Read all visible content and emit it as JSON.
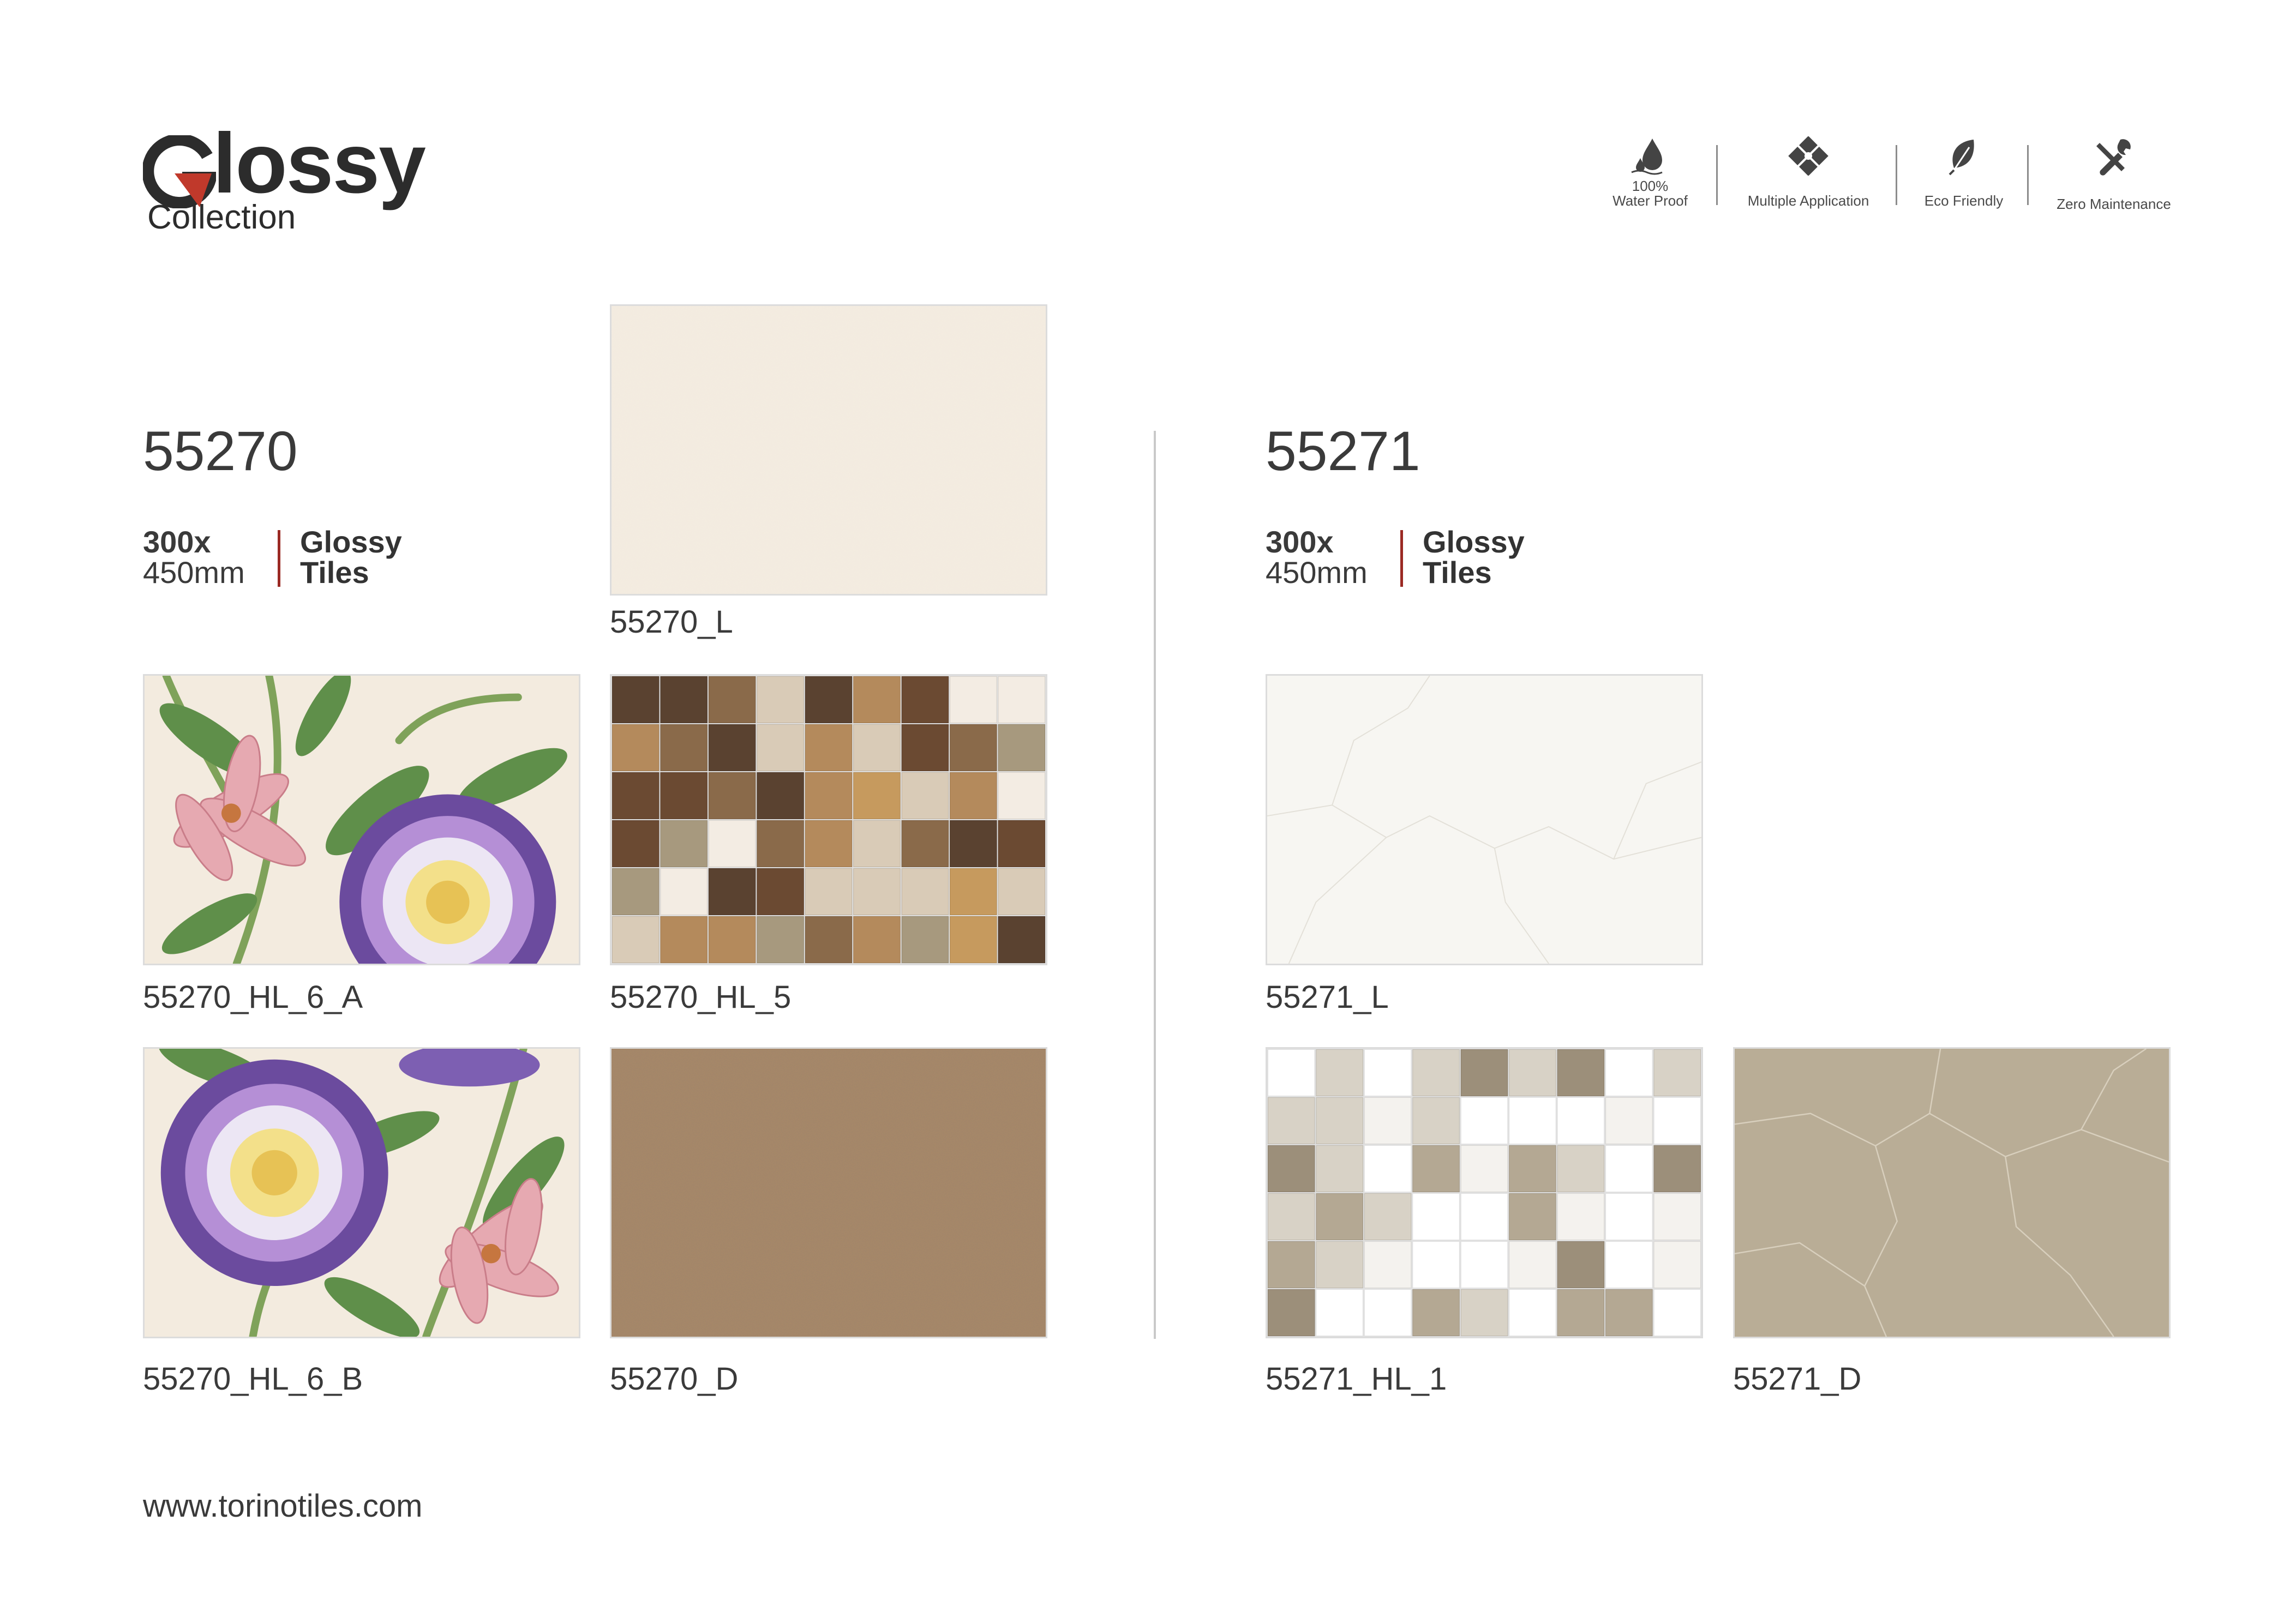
{
  "brand": {
    "logo_letter": "G",
    "word": "lossy",
    "subtitle": "Collection",
    "accent_color": "#c0392b"
  },
  "features": [
    {
      "icon": "water-drop-icon",
      "line1": "100%",
      "line2": "Water Proof"
    },
    {
      "icon": "tiles-diamond-icon",
      "line1": "",
      "line2": "Multiple Application"
    },
    {
      "icon": "leaf-icon",
      "line1": "",
      "line2": "Eco Friendly"
    },
    {
      "icon": "tools-icon",
      "line1": "",
      "line2": "Zero Maintenance"
    }
  ],
  "series": [
    {
      "code": "55270",
      "size_line1": "300x",
      "size_line2": "450mm",
      "type_line1": "Glossy",
      "type_line2": "Tiles",
      "tiles": [
        "55270_L",
        "55270_HL_6_A",
        "55270_HL_5",
        "55270_HL_6_B",
        "55270_D"
      ]
    },
    {
      "code": "55271",
      "size_line1": "300x",
      "size_line2": "450mm",
      "type_line1": "Glossy",
      "type_line2": "Tiles",
      "tiles": [
        "55271_L",
        "55271_HL_1",
        "55271_D"
      ]
    }
  ],
  "footer": {
    "website": "www.torinotiles.com"
  }
}
